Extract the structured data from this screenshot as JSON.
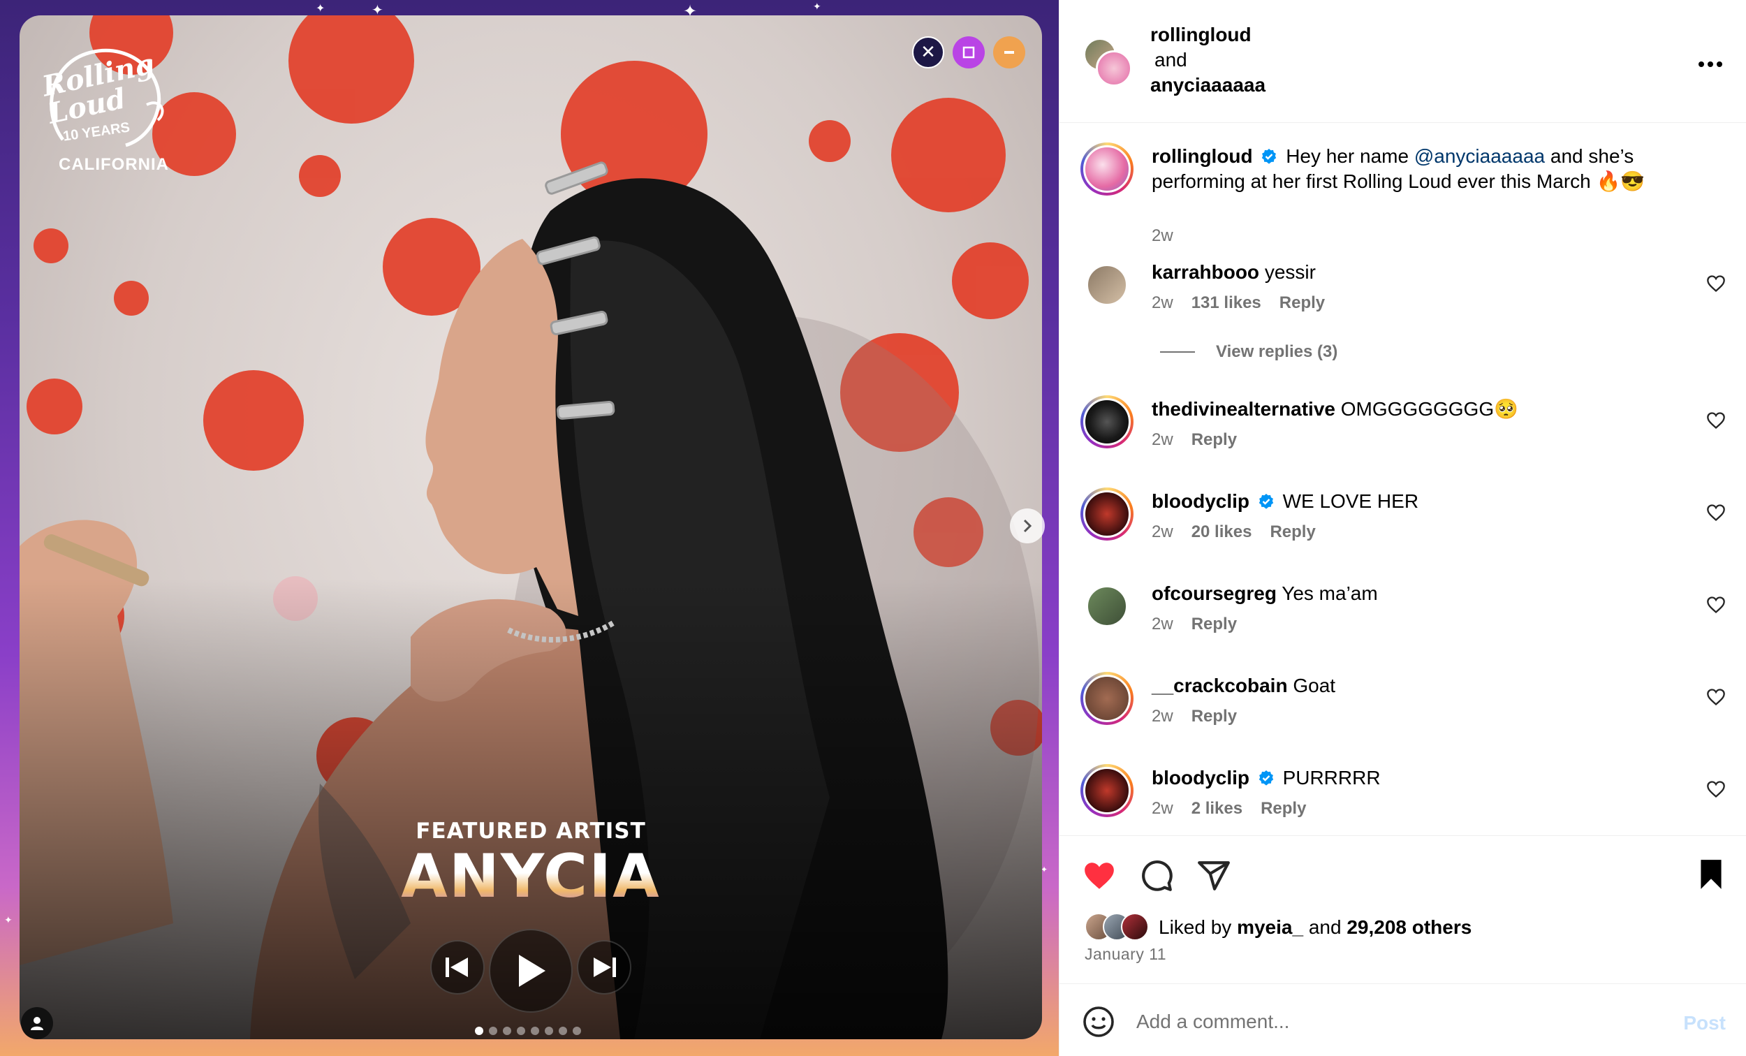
{
  "media": {
    "logo_brand": "Rolling Loud",
    "logo_years": "10 YEARS",
    "logo_location": "CALIFORNIA",
    "featured_label": "FEATURED ARTIST",
    "artist_name": "ANYCIA",
    "carousel_count": 8,
    "carousel_active_index": 0,
    "window_controls": [
      "close-icon",
      "maximize-icon",
      "minimize-icon"
    ]
  },
  "header": {
    "user1": "rollingloud",
    "and": "and",
    "user2": "anyciaaaaaa",
    "more_icon": "more-horizontal-icon"
  },
  "caption": {
    "username": "rollingloud",
    "verified": true,
    "text_before": "Hey her name",
    "mention": "@anyciaaaaaa",
    "text_after": "and she’s performing at her first Rolling Loud ever this March 🔥😎",
    "time": "2w"
  },
  "comments": [
    {
      "username": "karrahbooo",
      "verified": false,
      "text": "yessir",
      "time": "2w",
      "likes": "131 likes",
      "reply": "Reply",
      "view_replies": "View replies (3)"
    },
    {
      "username": "thedivinealternative",
      "verified": false,
      "text": "OMGGGGGGGG🥺",
      "time": "2w",
      "likes": "",
      "reply": "Reply"
    },
    {
      "username": "bloodyclip",
      "verified": true,
      "text": "WE LOVE HER",
      "time": "2w",
      "likes": "20 likes",
      "reply": "Reply"
    },
    {
      "username": "ofcoursegreg",
      "verified": false,
      "text": "Yes ma’am",
      "time": "2w",
      "likes": "",
      "reply": "Reply"
    },
    {
      "username": "__crackcobain",
      "verified": false,
      "text": "Goat",
      "time": "2w",
      "likes": "",
      "reply": "Reply"
    },
    {
      "username": "bloodyclip",
      "verified": true,
      "text": "PURRRRR",
      "time": "2w",
      "likes": "2 likes",
      "reply": "Reply"
    }
  ],
  "actions": {
    "liked_prefix": "Liked by",
    "liked_user": "myeia_",
    "liked_and": "and",
    "liked_others": "29,208 others",
    "date": "January 11",
    "liked_state": true,
    "saved_state": true
  },
  "add_comment": {
    "placeholder": "Add a comment...",
    "post_label": "Post"
  },
  "colors": {
    "like_red": "#ff3040",
    "verified_blue": "#0095f6",
    "mention_blue": "#00376b",
    "muted_text": "#737373",
    "post_disabled": "#c7e1fc"
  }
}
